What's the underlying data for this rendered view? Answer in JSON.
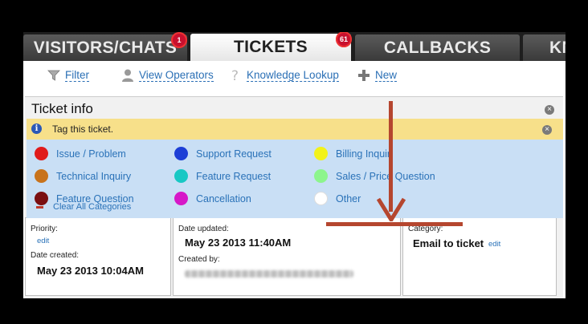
{
  "tabs": [
    {
      "label": "VISITORS/CHATS",
      "badge": "1",
      "active": false
    },
    {
      "label": "TICKETS",
      "badge": "61",
      "active": true
    },
    {
      "label": "CALLBACKS",
      "active": false
    },
    {
      "label": "KN",
      "active": false
    }
  ],
  "toolbar": {
    "filter": "Filter",
    "view_operators": "View Operators",
    "knowledge_lookup": "Knowledge Lookup",
    "new": "New"
  },
  "panel": {
    "title": "Ticket info",
    "tag_prompt": "Tag this ticket.",
    "categories": [
      {
        "label": "Issue / Problem",
        "color": "#e01b1b"
      },
      {
        "label": "Support Request",
        "color": "#1d3fd6"
      },
      {
        "label": "Billing Inquir",
        "color": "#f2f21a"
      },
      {
        "label": "Technical Inquiry",
        "color": "#c8731c"
      },
      {
        "label": "Feature Request",
        "color": "#18c8c4"
      },
      {
        "label": "Sales / Price Question",
        "color": "#8df58d"
      },
      {
        "label": "Feature Question",
        "color": "#7a0f12"
      },
      {
        "label": "Cancellation",
        "color": "#d618c8"
      },
      {
        "label": "Other",
        "color": "#ffffff"
      }
    ],
    "clear_all": "Clear All Categories"
  },
  "details": {
    "priority_label": "Priority:",
    "edit": "edit",
    "date_created_label": "Date created:",
    "date_created": "May 23 2013 10:04AM",
    "date_updated_label": "Date updated:",
    "date_updated": "May 23 2013 11:40AM",
    "created_by_label": "Created by:",
    "category_label": "Category:",
    "category_value": "Email to ticket"
  },
  "colors": {
    "accent": "#2a72b8",
    "annotation": "#b5462f",
    "tag_bar": "#f7e08a",
    "tag_box": "#c9dff5"
  }
}
